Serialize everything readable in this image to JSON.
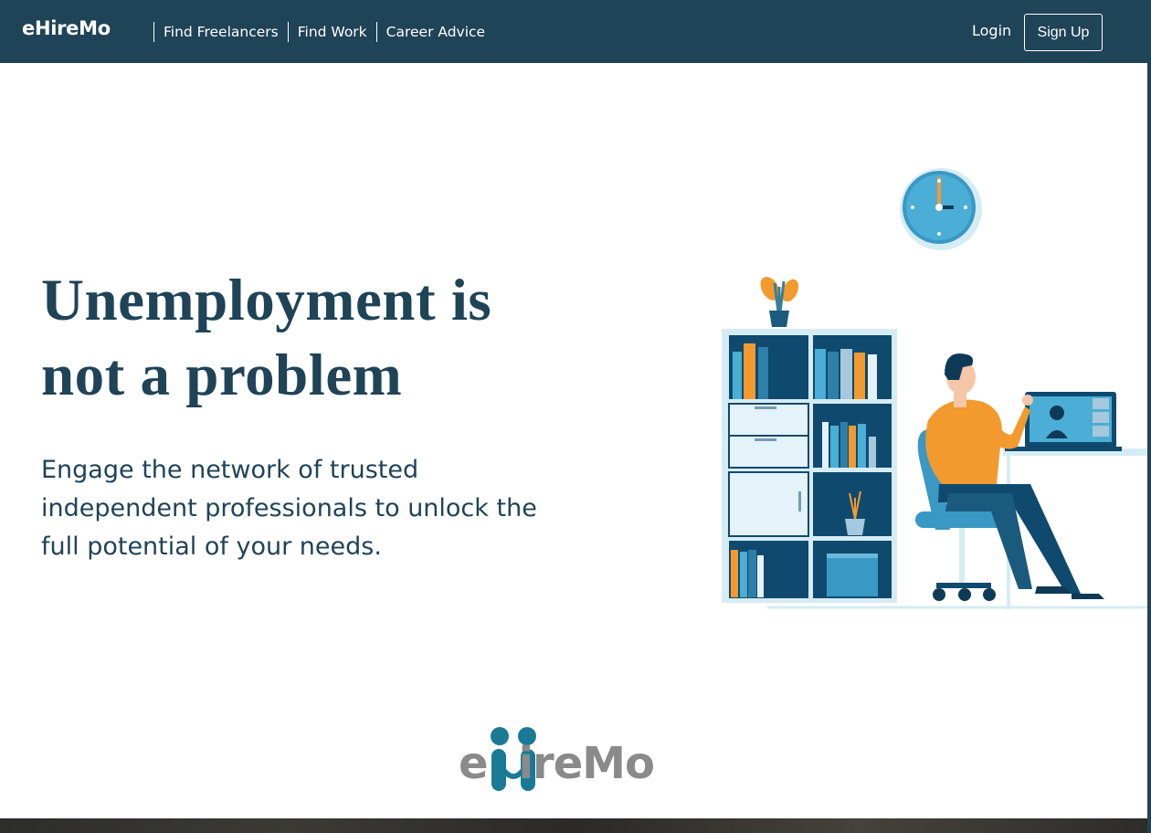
{
  "navbar": {
    "brand": "eHireMo",
    "links": [
      "Find Freelancers",
      "Find Work",
      "Career Advice"
    ],
    "login_label": "Login",
    "signup_label": "Sign Up",
    "bg_color": "#1f4357"
  },
  "hero": {
    "headline_line1": "Unemployment is",
    "headline_line2": "not a problem",
    "subtext": "Engage the network of trusted independent professionals to unlock the full potential of your needs.",
    "illustration": "person-at-desk-video-call-illustration"
  },
  "footer": {
    "logo_e": "e",
    "logo_rest": "ireMo",
    "logo_icon": "people-h-icon",
    "logo_primary_color": "#1a7a96",
    "logo_text_color": "#8a8a8a"
  }
}
